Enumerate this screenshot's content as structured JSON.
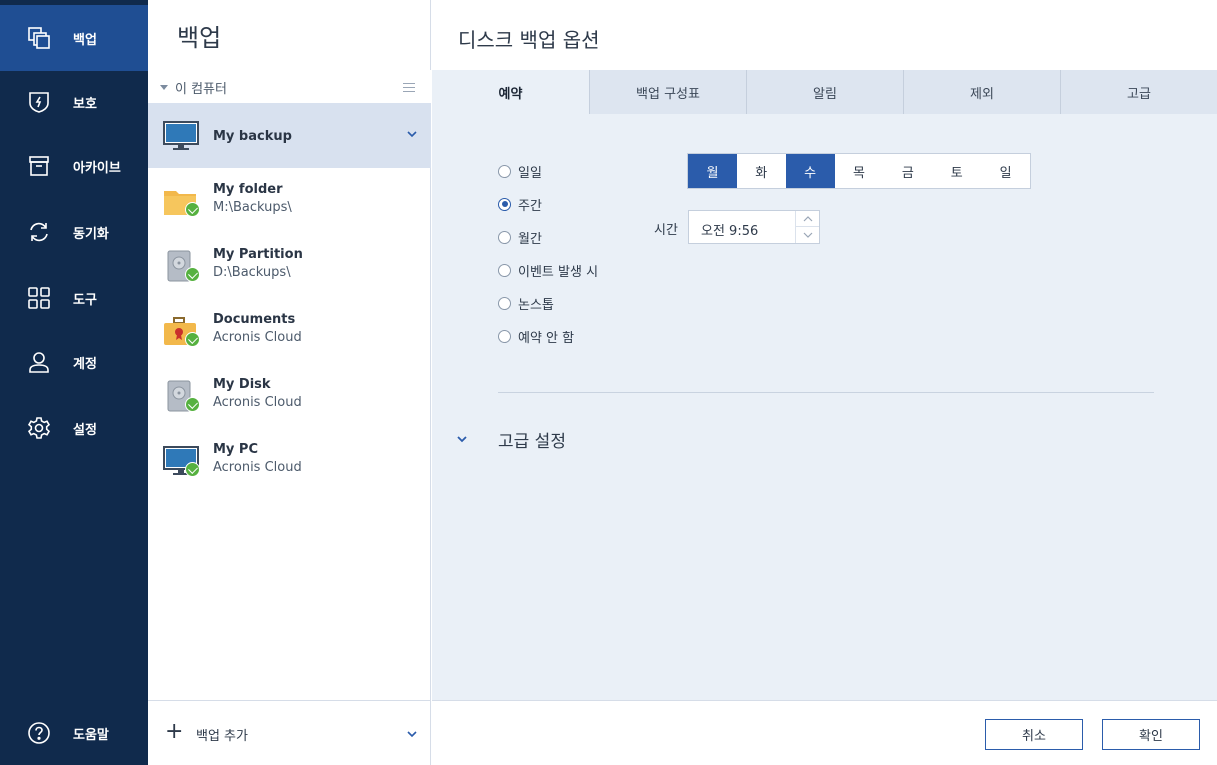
{
  "nav": {
    "items": [
      {
        "label": "백업",
        "icon": "backup-icon"
      },
      {
        "label": "보호",
        "icon": "shield-icon"
      },
      {
        "label": "아카이브",
        "icon": "archive-icon"
      },
      {
        "label": "동기화",
        "icon": "sync-icon"
      },
      {
        "label": "도구",
        "icon": "tools-grid-icon"
      },
      {
        "label": "계정",
        "icon": "account-icon"
      },
      {
        "label": "설정",
        "icon": "gear-icon"
      }
    ],
    "help_label": "도움말",
    "active_color": "#1f4e93",
    "bg_color": "#102a4c"
  },
  "backups": {
    "title": "백업",
    "group_label": "이 컴퓨터",
    "items": [
      {
        "name": "My backup",
        "sub": "",
        "icon": "monitor-icon"
      },
      {
        "name": "My folder",
        "sub": "M:\\Backups\\",
        "icon": "folder-icon"
      },
      {
        "name": "My Partition",
        "sub": "D:\\Backups\\",
        "icon": "drive-icon"
      },
      {
        "name": "Documents",
        "sub": "Acronis Cloud",
        "icon": "briefcase-icon"
      },
      {
        "name": "My Disk",
        "sub": "Acronis Cloud",
        "icon": "drive-icon"
      },
      {
        "name": "My PC",
        "sub": "Acronis Cloud",
        "icon": "monitor-icon"
      }
    ],
    "add_label": "백업 추가"
  },
  "options": {
    "title": "디스크 백업 옵션",
    "tabs": [
      "예약",
      "백업 구성표",
      "알림",
      "제외",
      "고급"
    ],
    "schedule": {
      "radios": [
        "일일",
        "주간",
        "월간",
        "이벤트 발생 시",
        "논스톱",
        "예약 안 함"
      ],
      "selected": "주간",
      "days": [
        "월",
        "화",
        "수",
        "목",
        "금",
        "토",
        "일"
      ],
      "selected_days": [
        "월",
        "수"
      ],
      "time_label": "시간",
      "time_value": "오전 9:56"
    },
    "advanced_label": "고급 설정",
    "cancel_label": "취소",
    "ok_label": "확인",
    "accent_color": "#2b5cab"
  }
}
